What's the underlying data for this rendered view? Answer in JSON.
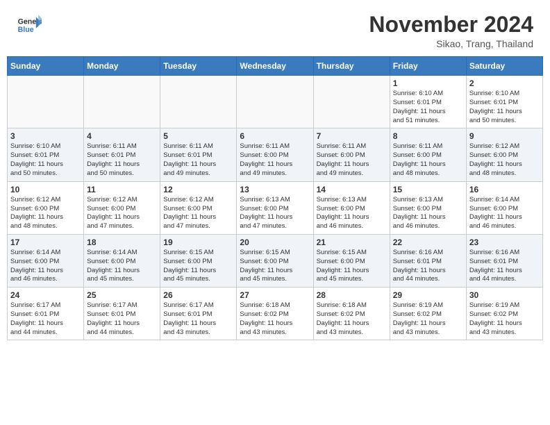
{
  "header": {
    "logo_line1": "General",
    "logo_line2": "Blue",
    "month": "November 2024",
    "location": "Sikao, Trang, Thailand"
  },
  "weekdays": [
    "Sunday",
    "Monday",
    "Tuesday",
    "Wednesday",
    "Thursday",
    "Friday",
    "Saturday"
  ],
  "weeks": [
    [
      {
        "day": "",
        "info": ""
      },
      {
        "day": "",
        "info": ""
      },
      {
        "day": "",
        "info": ""
      },
      {
        "day": "",
        "info": ""
      },
      {
        "day": "",
        "info": ""
      },
      {
        "day": "1",
        "info": "Sunrise: 6:10 AM\nSunset: 6:01 PM\nDaylight: 11 hours\nand 51 minutes."
      },
      {
        "day": "2",
        "info": "Sunrise: 6:10 AM\nSunset: 6:01 PM\nDaylight: 11 hours\nand 50 minutes."
      }
    ],
    [
      {
        "day": "3",
        "info": "Sunrise: 6:10 AM\nSunset: 6:01 PM\nDaylight: 11 hours\nand 50 minutes."
      },
      {
        "day": "4",
        "info": "Sunrise: 6:11 AM\nSunset: 6:01 PM\nDaylight: 11 hours\nand 50 minutes."
      },
      {
        "day": "5",
        "info": "Sunrise: 6:11 AM\nSunset: 6:01 PM\nDaylight: 11 hours\nand 49 minutes."
      },
      {
        "day": "6",
        "info": "Sunrise: 6:11 AM\nSunset: 6:00 PM\nDaylight: 11 hours\nand 49 minutes."
      },
      {
        "day": "7",
        "info": "Sunrise: 6:11 AM\nSunset: 6:00 PM\nDaylight: 11 hours\nand 49 minutes."
      },
      {
        "day": "8",
        "info": "Sunrise: 6:11 AM\nSunset: 6:00 PM\nDaylight: 11 hours\nand 48 minutes."
      },
      {
        "day": "9",
        "info": "Sunrise: 6:12 AM\nSunset: 6:00 PM\nDaylight: 11 hours\nand 48 minutes."
      }
    ],
    [
      {
        "day": "10",
        "info": "Sunrise: 6:12 AM\nSunset: 6:00 PM\nDaylight: 11 hours\nand 48 minutes."
      },
      {
        "day": "11",
        "info": "Sunrise: 6:12 AM\nSunset: 6:00 PM\nDaylight: 11 hours\nand 47 minutes."
      },
      {
        "day": "12",
        "info": "Sunrise: 6:12 AM\nSunset: 6:00 PM\nDaylight: 11 hours\nand 47 minutes."
      },
      {
        "day": "13",
        "info": "Sunrise: 6:13 AM\nSunset: 6:00 PM\nDaylight: 11 hours\nand 47 minutes."
      },
      {
        "day": "14",
        "info": "Sunrise: 6:13 AM\nSunset: 6:00 PM\nDaylight: 11 hours\nand 46 minutes."
      },
      {
        "day": "15",
        "info": "Sunrise: 6:13 AM\nSunset: 6:00 PM\nDaylight: 11 hours\nand 46 minutes."
      },
      {
        "day": "16",
        "info": "Sunrise: 6:14 AM\nSunset: 6:00 PM\nDaylight: 11 hours\nand 46 minutes."
      }
    ],
    [
      {
        "day": "17",
        "info": "Sunrise: 6:14 AM\nSunset: 6:00 PM\nDaylight: 11 hours\nand 46 minutes."
      },
      {
        "day": "18",
        "info": "Sunrise: 6:14 AM\nSunset: 6:00 PM\nDaylight: 11 hours\nand 45 minutes."
      },
      {
        "day": "19",
        "info": "Sunrise: 6:15 AM\nSunset: 6:00 PM\nDaylight: 11 hours\nand 45 minutes."
      },
      {
        "day": "20",
        "info": "Sunrise: 6:15 AM\nSunset: 6:00 PM\nDaylight: 11 hours\nand 45 minutes."
      },
      {
        "day": "21",
        "info": "Sunrise: 6:15 AM\nSunset: 6:00 PM\nDaylight: 11 hours\nand 45 minutes."
      },
      {
        "day": "22",
        "info": "Sunrise: 6:16 AM\nSunset: 6:01 PM\nDaylight: 11 hours\nand 44 minutes."
      },
      {
        "day": "23",
        "info": "Sunrise: 6:16 AM\nSunset: 6:01 PM\nDaylight: 11 hours\nand 44 minutes."
      }
    ],
    [
      {
        "day": "24",
        "info": "Sunrise: 6:17 AM\nSunset: 6:01 PM\nDaylight: 11 hours\nand 44 minutes."
      },
      {
        "day": "25",
        "info": "Sunrise: 6:17 AM\nSunset: 6:01 PM\nDaylight: 11 hours\nand 44 minutes."
      },
      {
        "day": "26",
        "info": "Sunrise: 6:17 AM\nSunset: 6:01 PM\nDaylight: 11 hours\nand 43 minutes."
      },
      {
        "day": "27",
        "info": "Sunrise: 6:18 AM\nSunset: 6:02 PM\nDaylight: 11 hours\nand 43 minutes."
      },
      {
        "day": "28",
        "info": "Sunrise: 6:18 AM\nSunset: 6:02 PM\nDaylight: 11 hours\nand 43 minutes."
      },
      {
        "day": "29",
        "info": "Sunrise: 6:19 AM\nSunset: 6:02 PM\nDaylight: 11 hours\nand 43 minutes."
      },
      {
        "day": "30",
        "info": "Sunrise: 6:19 AM\nSunset: 6:02 PM\nDaylight: 11 hours\nand 43 minutes."
      }
    ]
  ]
}
